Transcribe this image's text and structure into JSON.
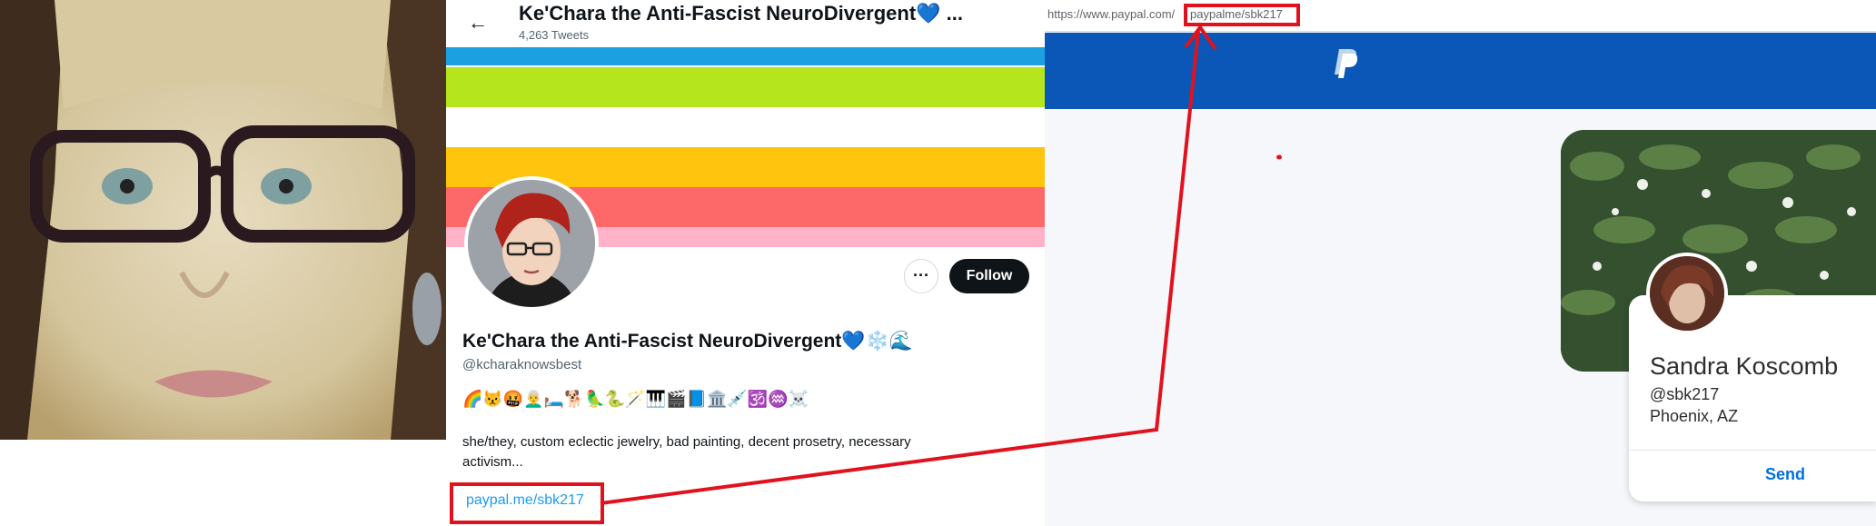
{
  "twitter": {
    "back_icon": "←",
    "header_title": "Ke'Chara the Anti-Fascist NeuroDivergent💙 ...",
    "tweet_count": "4,263 Tweets",
    "banner_stripes": [
      "#1ba1e2",
      "#ffffff",
      "#b5e61d",
      "#ffffff",
      "#ffc40d",
      "#fd6868",
      "#ffb2c8"
    ],
    "more_icon": "···",
    "follow_label": "Follow",
    "display_name": "Ke'Chara the Anti-Fascist NeuroDivergent💙❄️🌊",
    "handle": "@kcharaknowsbest",
    "emoji_line": "🌈😾🤬👨‍🦳🛏️🐕🦜🐍🪄🎹🎬📘🏛️💉🕉️♒☠️",
    "bio": "she/they, custom eclectic jewelry, bad painting, decent prosetry, necessary activism...",
    "link": "paypal.me/sbk217"
  },
  "paypal": {
    "url_prefix": "https://www.paypal.com/",
    "url_path": "paypalme/sbk217",
    "logo_icon": "paypal-logo",
    "name": "Sandra Koscomb",
    "handle": "@sbk217",
    "location": "Phoenix, AZ",
    "send_label": "Send",
    "brand_color": "#0a57b8"
  },
  "annotation_color": "#e0121d"
}
